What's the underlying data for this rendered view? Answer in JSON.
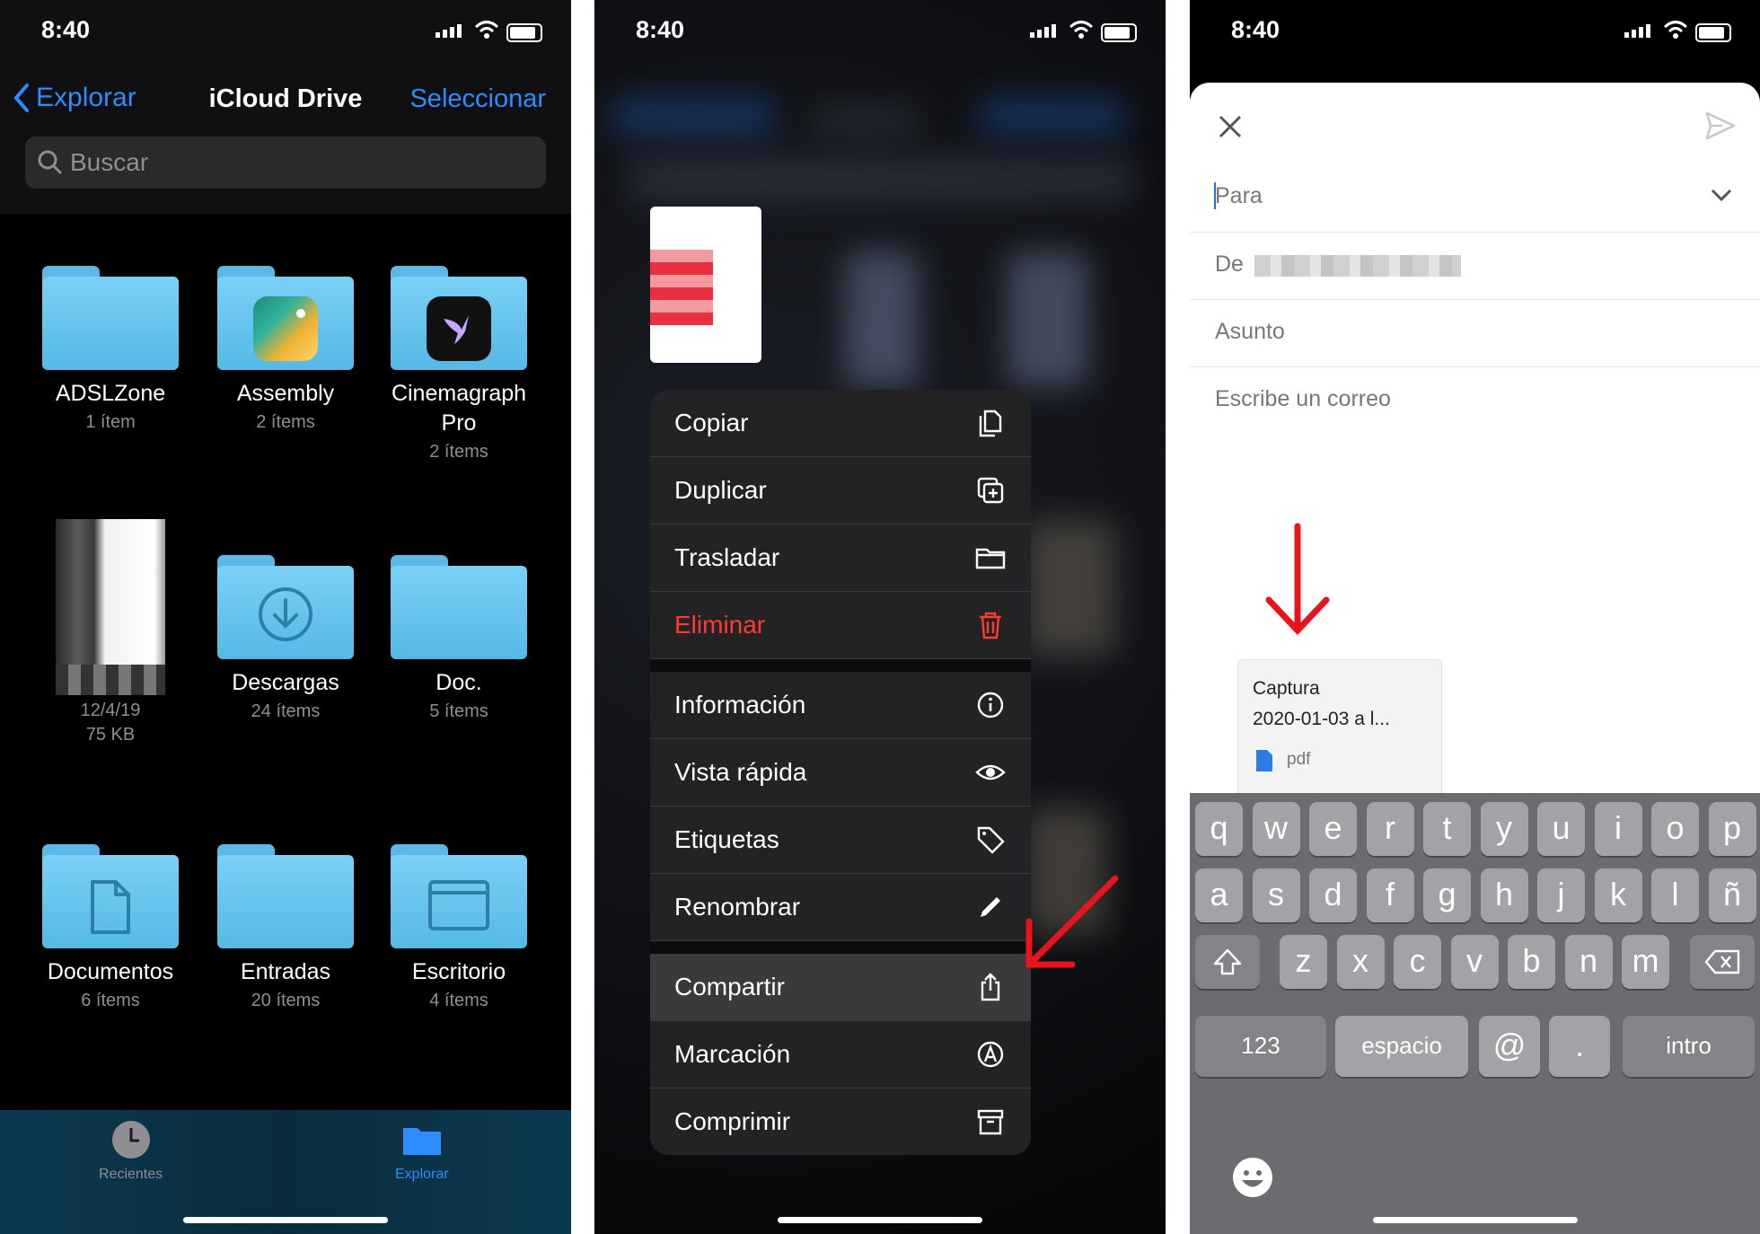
{
  "status": {
    "time": "8:40"
  },
  "screen1": {
    "back_label": "Explorar",
    "title": "iCloud Drive",
    "select_label": "Seleccionar",
    "search_placeholder": "Buscar",
    "items": [
      {
        "name": "ADSLZone",
        "sub": "1 ítem"
      },
      {
        "name": "Assembly",
        "sub": "2 ítems"
      },
      {
        "name": "Cinemagraph",
        "name2": "Pro",
        "sub": "2 ítems"
      },
      {
        "name": "",
        "sub": "12/4/19",
        "sub2": "75 KB"
      },
      {
        "name": "Descargas",
        "sub": "24 ítems"
      },
      {
        "name": "Doc.",
        "sub": "5 ítems"
      },
      {
        "name": "Documentos",
        "sub": "6 ítems"
      },
      {
        "name": "Entradas",
        "sub": "20 ítems"
      },
      {
        "name": "Escritorio",
        "sub": "4 ítems"
      }
    ],
    "tabs": [
      {
        "label": "Recientes"
      },
      {
        "label": "Explorar"
      }
    ]
  },
  "screen2": {
    "menu": [
      {
        "label": "Copiar",
        "icon": "copy-icon"
      },
      {
        "label": "Duplicar",
        "icon": "duplicate-icon"
      },
      {
        "label": "Trasladar",
        "icon": "folder-icon"
      },
      {
        "label": "Eliminar",
        "icon": "trash-icon"
      },
      {
        "label": "Información",
        "icon": "info-icon"
      },
      {
        "label": "Vista rápida",
        "icon": "eye-icon"
      },
      {
        "label": "Etiquetas",
        "icon": "tag-icon"
      },
      {
        "label": "Renombrar",
        "icon": "pencil-icon"
      },
      {
        "label": "Compartir",
        "icon": "share-icon"
      },
      {
        "label": "Marcación",
        "icon": "markup-icon"
      },
      {
        "label": "Comprimir",
        "icon": "archive-icon"
      }
    ]
  },
  "screen3": {
    "to_label": "Para",
    "from_label": "De",
    "subject_placeholder": "Asunto",
    "body_placeholder": "Escribe un correo",
    "attachment": {
      "line1": "Captura",
      "line2": "2020-01-03 a l...",
      "type": "pdf"
    },
    "keyboard": {
      "row1": [
        "q",
        "w",
        "e",
        "r",
        "t",
        "y",
        "u",
        "i",
        "o",
        "p"
      ],
      "row2": [
        "a",
        "s",
        "d",
        "f",
        "g",
        "h",
        "j",
        "k",
        "l",
        "ñ"
      ],
      "row3": [
        "z",
        "x",
        "c",
        "v",
        "b",
        "n",
        "m"
      ],
      "numbers": "123",
      "space": "espacio",
      "at": "@",
      "dot": ".",
      "return": "intro"
    }
  },
  "colors": {
    "accent": "#2d8cff",
    "folder": "#66c4ef",
    "destructive": "#ff3b30",
    "annotation": "#e8141c"
  }
}
